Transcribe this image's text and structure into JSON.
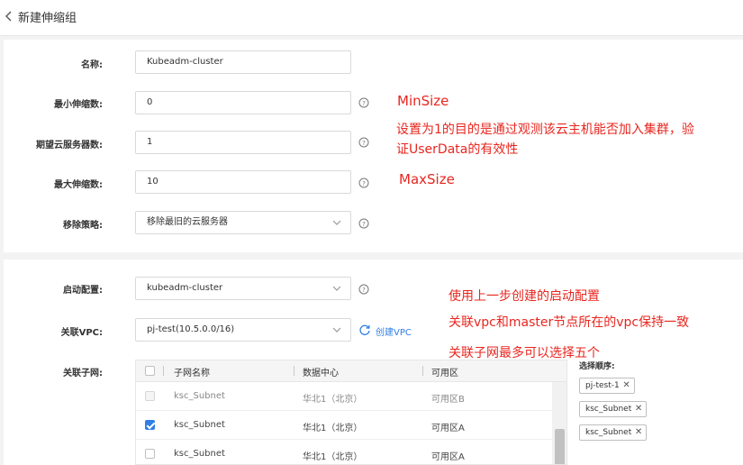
{
  "header": {
    "title": "新建伸缩组"
  },
  "form": {
    "name": {
      "label": "名称:",
      "value": "Kubeadm-cluster"
    },
    "min_size": {
      "label": "最小伸缩数:",
      "value": "0"
    },
    "desired": {
      "label": "期望云服务器数:",
      "value": "1"
    },
    "max_size": {
      "label": "最大伸缩数:",
      "value": "10"
    },
    "removal_policy": {
      "label": "移除策略:",
      "value": "移除最旧的云服务器"
    },
    "launch_config": {
      "label": "启动配置:",
      "value": "kubeadm-cluster"
    },
    "vpc": {
      "label": "关联VPC:",
      "value": "pj-test(10.5.0.0/16)",
      "create_link": "创建VPC"
    },
    "subnet": {
      "label": "关联子网:"
    }
  },
  "subnet_table": {
    "columns": [
      "子网名称",
      "数据中心",
      "可用区"
    ],
    "rows": [
      {
        "name": "ksc_Subnet",
        "dc": "华北1（北京）",
        "zone": "可用区B",
        "state": "disabled"
      },
      {
        "name": "ksc_Subnet",
        "dc": "华北1（北京）",
        "zone": "可用区A",
        "state": "checked"
      },
      {
        "name": "ksc_Subnet",
        "dc": "华北1（北京）",
        "zone": "可用区A",
        "state": "unchecked"
      }
    ]
  },
  "selection_order": {
    "label": "选择顺序:",
    "tags": [
      "pj-test-1",
      "ksc_Subnet",
      "ksc_Subnet"
    ]
  },
  "annotations": {
    "minsize": "MinSize",
    "desired_note": "设置为1的目的是通过观测该云主机能否加入集群，验证UserData的有效性",
    "desired_line1": "设置为1的目的是通过观测该云主机能否加入集群，验",
    "desired_line2": "证UserData的有效性",
    "maxsize": "MaxSize",
    "launch_note": "使用上一步创建的启动配置",
    "vpc_note": "关联vpc和master节点所在的vpc保持一致",
    "subnet_note": "关联子网最多可以选择五个"
  },
  "colors": {
    "annotation": "#e8261f",
    "link": "#2f7fe6",
    "check": "#2f7fe6"
  }
}
